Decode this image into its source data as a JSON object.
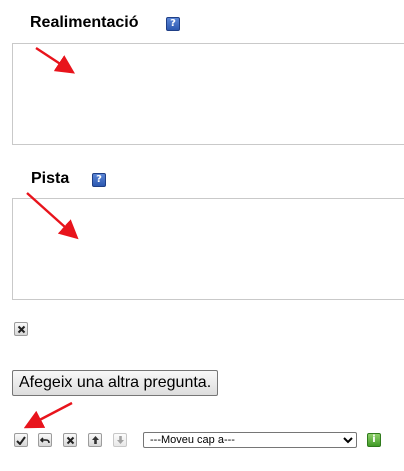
{
  "feedback": {
    "label": "Realimentació",
    "help_icon": "question-mark-icon",
    "value": ""
  },
  "hint": {
    "label": "Pista",
    "help_icon": "question-mark-icon",
    "value": ""
  },
  "remove_icon": "close-x-icon",
  "add_question_button": "Afegeix una altra pregunta.",
  "question_toolbar": {
    "icons": [
      "checkmark-icon",
      "undo-icon",
      "delete-icon",
      "move-up-icon",
      "move-down-icon"
    ],
    "move_select": {
      "selected": "---Moveu cap a---",
      "options": [
        "---Moveu cap a---"
      ]
    },
    "info_icon": "info-icon"
  },
  "colors": {
    "annotation_arrow": "#e8141c",
    "help_icon_blue": "#2c58b0",
    "info_icon_green": "#3f9a26",
    "border_gray": "#c9c9c9"
  }
}
